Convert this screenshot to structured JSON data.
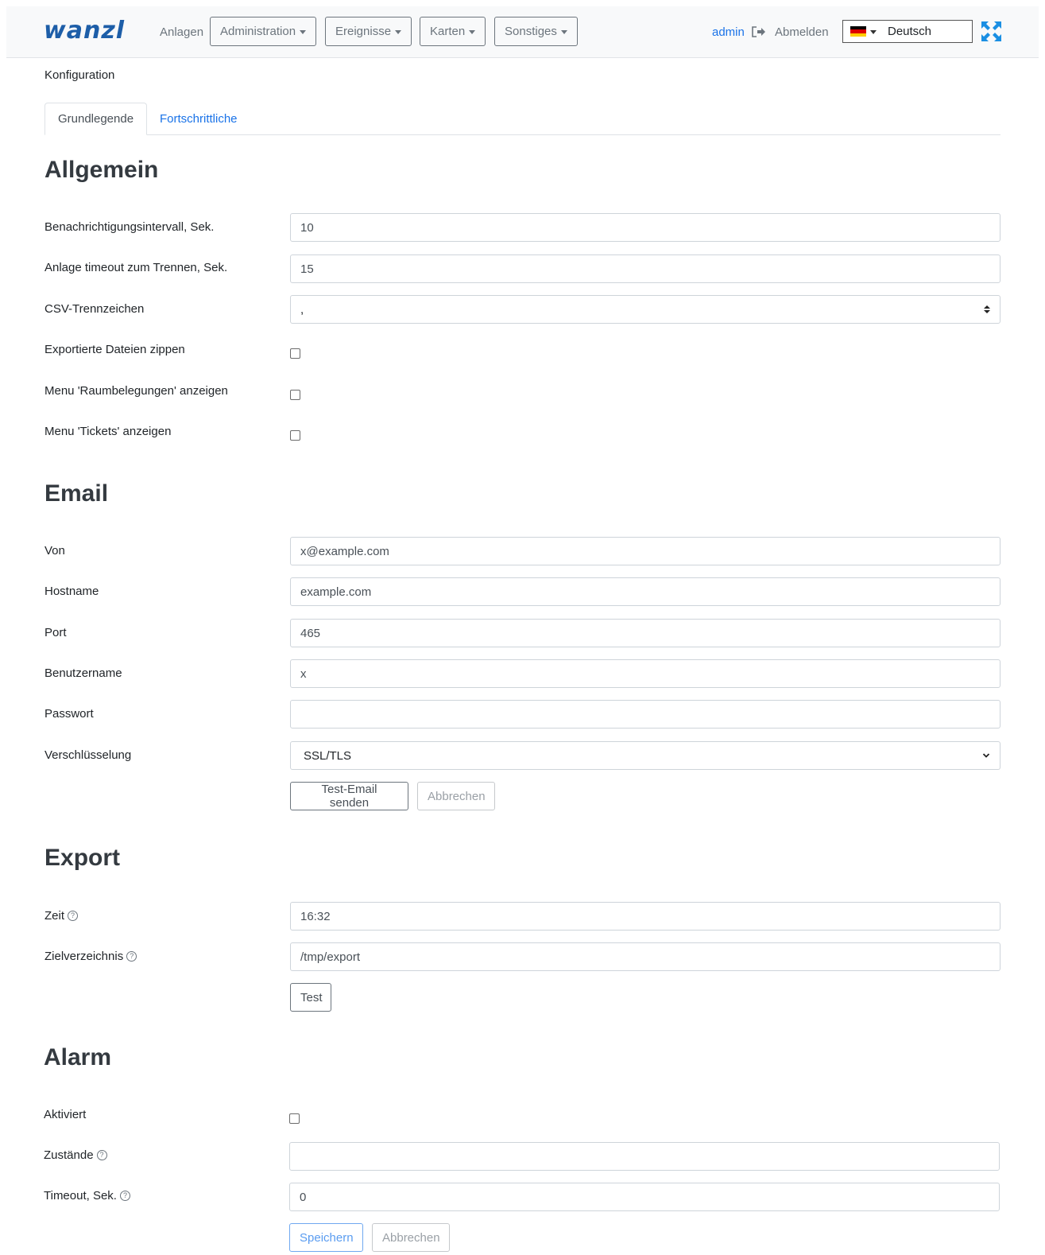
{
  "nav": {
    "logo": "wanzl",
    "anlagen": "Anlagen",
    "menus": [
      "Administration",
      "Ereignisse",
      "Karten",
      "Sonstiges"
    ],
    "user": "admin",
    "logout": "Abmelden",
    "language": "Deutsch"
  },
  "page": {
    "title": "Konfiguration",
    "tabs": [
      "Grundlegende",
      "Fortschrittliche"
    ]
  },
  "allgemein": {
    "heading": "Allgemein",
    "notify_interval_label": "Benachrichtigungsintervall, Sek.",
    "notify_interval_value": "10",
    "disconnect_timeout_label": "Anlage timeout zum Trennen, Sek.",
    "disconnect_timeout_value": "15",
    "csv_sep_label": "CSV-Trennzeichen",
    "csv_sep_value": ",",
    "zip_label": "Exportierte Dateien zippen",
    "raum_label": "Menu 'Raumbelegungen' anzeigen",
    "tickets_label": "Menu 'Tickets' anzeigen"
  },
  "email": {
    "heading": "Email",
    "from_label": "Von",
    "from_value": "x@example.com",
    "host_label": "Hostname",
    "host_value": "example.com",
    "port_label": "Port",
    "port_value": "465",
    "user_label": "Benutzername",
    "user_value": "x",
    "pass_label": "Passwort",
    "pass_value": "",
    "enc_label": "Verschlüsselung",
    "enc_value": "SSL/TLS",
    "test_btn": "Test-Email senden",
    "cancel_btn": "Abbrechen"
  },
  "export": {
    "heading": "Export",
    "time_label": "Zeit",
    "time_value": "16:32",
    "dir_label": "Zielverzeichnis",
    "dir_value": "/tmp/export",
    "test_btn": "Test"
  },
  "alarm": {
    "heading": "Alarm",
    "enabled_label": "Aktiviert",
    "states_label": "Zustände",
    "states_value": "",
    "timeout_label": "Timeout, Sek.",
    "timeout_value": "0",
    "save_btn": "Speichern",
    "cancel_btn": "Abbrechen"
  },
  "help_glyph": "?"
}
